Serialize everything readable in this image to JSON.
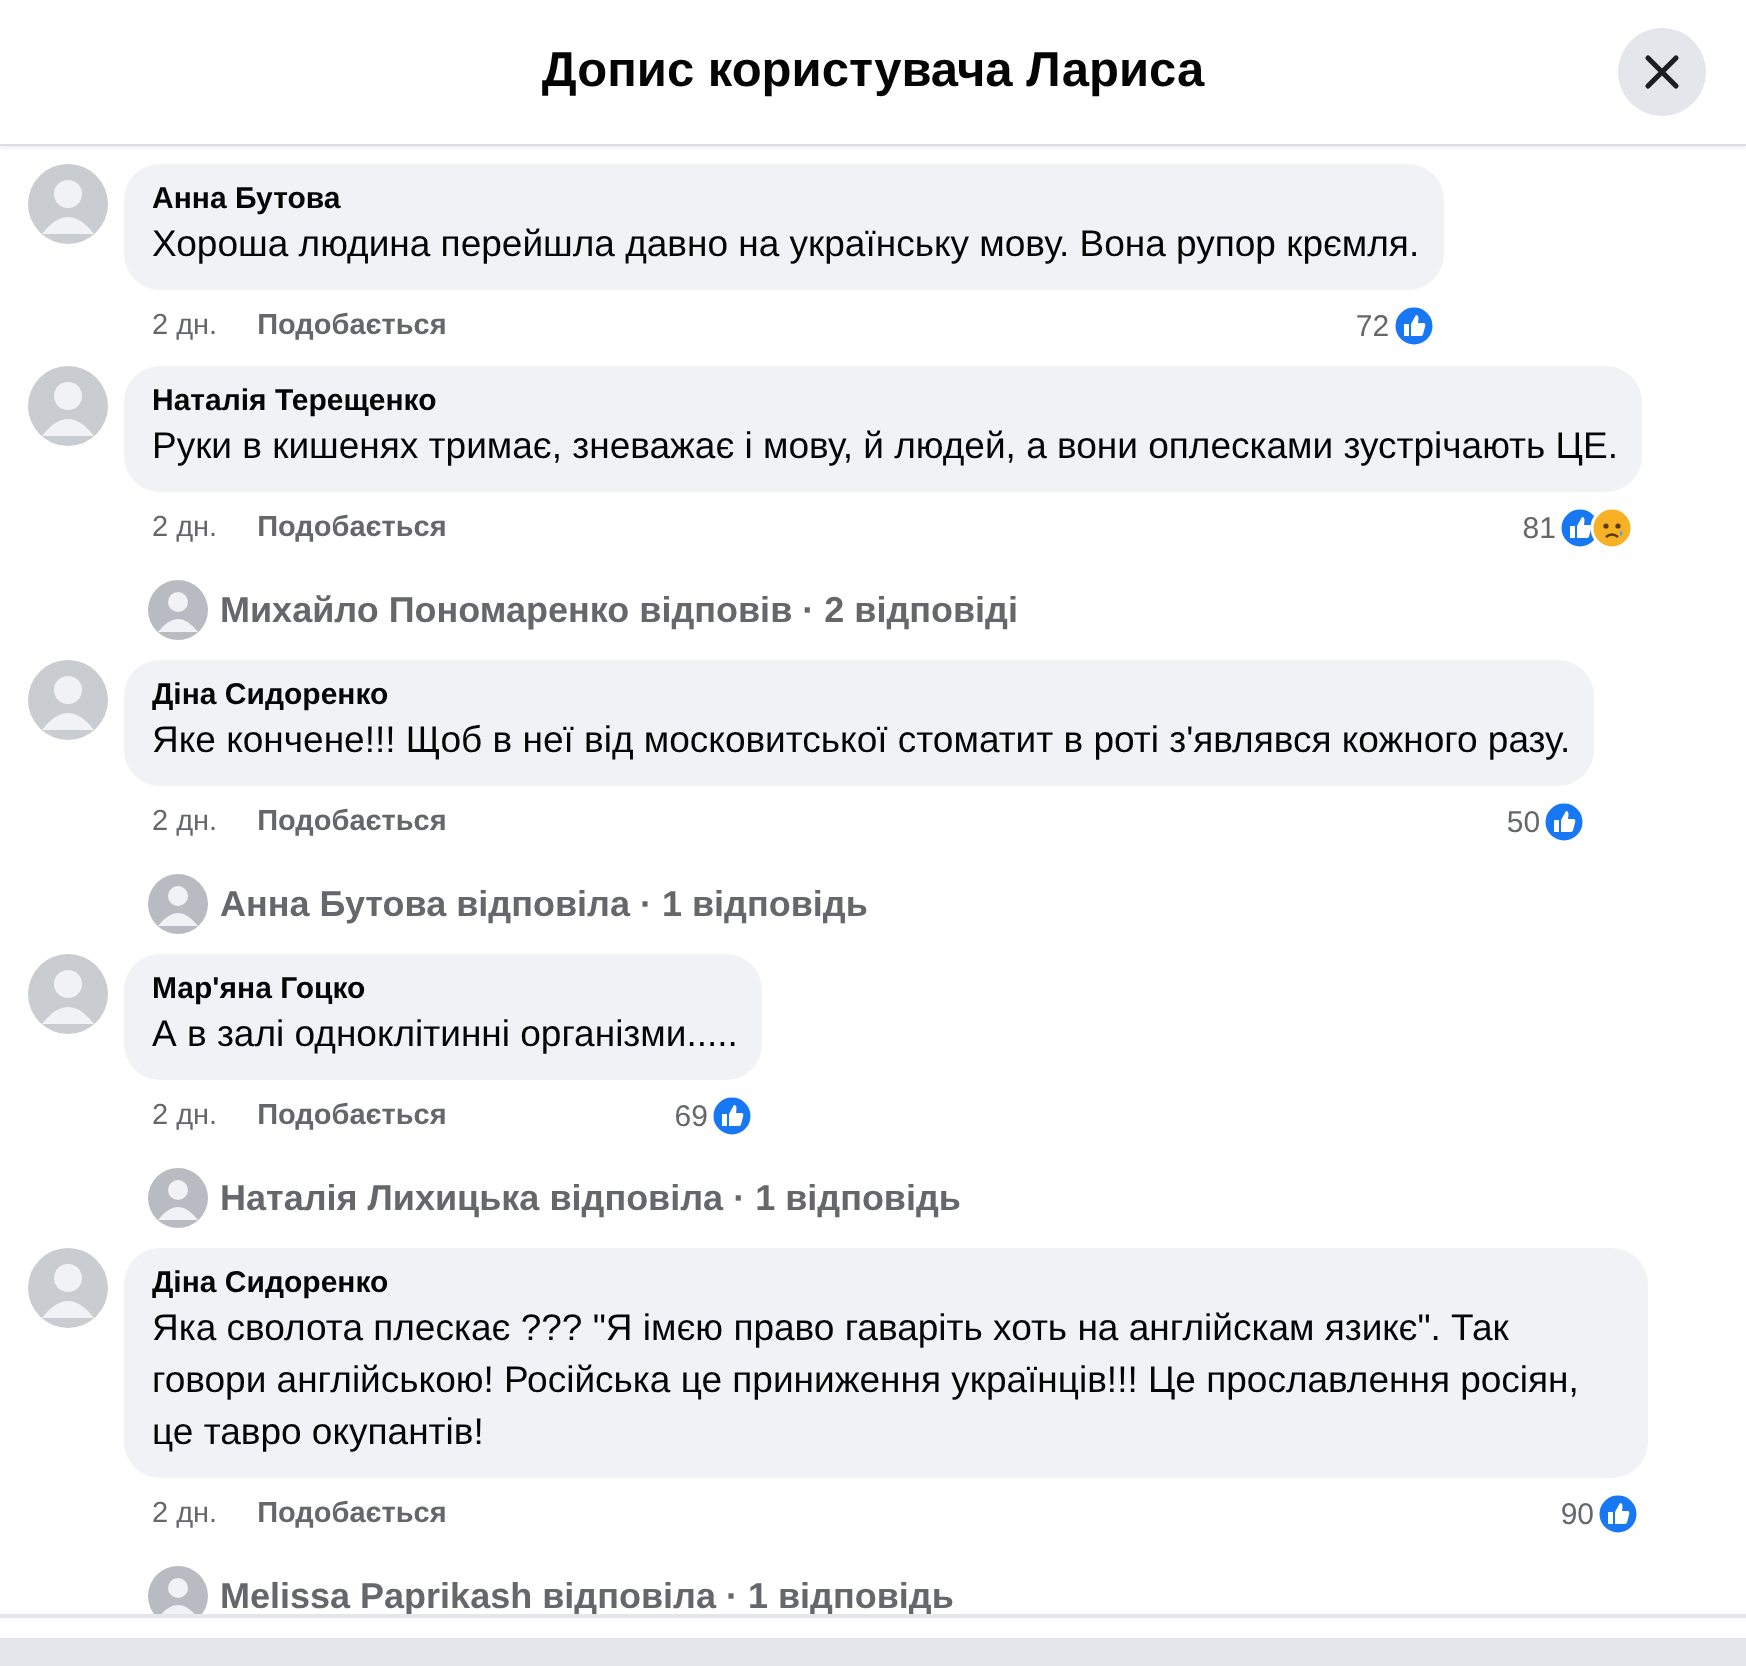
{
  "dialog": {
    "title": "Допис користувача Лариса"
  },
  "comments": [
    {
      "author": "Анна Бутова",
      "text": "Хороша людина перейшла давно на українську мову. Вона рупор крємля.",
      "time": "2 дн.",
      "like_label": "Подобається",
      "reaction_count": "72",
      "reactions": [
        {
          "kind": "like"
        }
      ]
    },
    {
      "author": "Наталія Терещенко",
      "text": "Руки в кишенях тримає, зневажає і мову, й людей, а вони оплесками зустрічають ЦЕ.",
      "time": "2 дн.",
      "like_label": "Подобається",
      "reaction_count": "81",
      "reactions": [
        {
          "kind": "like"
        },
        {
          "kind": "sad"
        }
      ],
      "replies": "Михайло Пономаренко відповів · 2 відповіді"
    },
    {
      "author": "Діна Сидоренко",
      "text": "Яке кончене!!! Щоб в неї від московитської стоматит в роті з'являвся кожного разу.",
      "time": "2 дн.",
      "like_label": "Подобається",
      "reaction_count": "50",
      "reactions": [
        {
          "kind": "like"
        }
      ],
      "replies": "Анна Бутова відповіла · 1 відповідь"
    },
    {
      "author": "Мар'яна Гоцко",
      "text": "А в залі одноклітинні організми.....",
      "time": "2 дн.",
      "like_label": "Подобається",
      "reaction_count": "69",
      "reactions": [
        {
          "kind": "like"
        }
      ],
      "replies": "Наталія Лихицька відповіла · 1 відповідь"
    },
    {
      "author": "Діна Сидоренко",
      "text": "Яка сволота плескає ??? \"Я імєю право гаваріть хоть на англійскам язикє\". Так говори англійською! Російська це приниження українців!!! Це прославлення росіян, це тавро окупантів!",
      "time": "2 дн.",
      "like_label": "Подобається",
      "reaction_count": "90",
      "reactions": [
        {
          "kind": "like"
        }
      ],
      "replies": "Melissa Paprikash відповіла · 1 відповідь"
    }
  ]
}
